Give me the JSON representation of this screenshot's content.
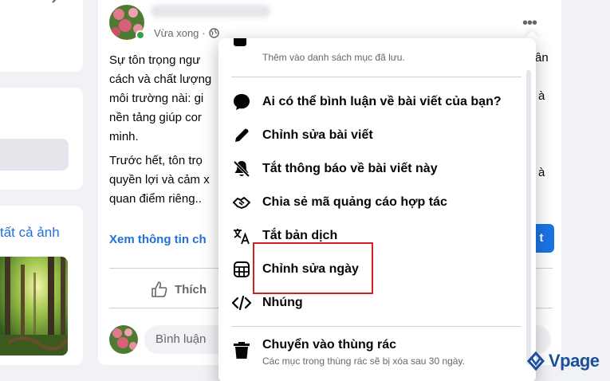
{
  "left": {
    "all_photos_link": "tất cả ảnh"
  },
  "post": {
    "timestamp": "Vừa xong",
    "separator": "·",
    "paragraph1": "Sự tôn trọng ngư",
    "paragraph1_l2": "cách và chất lượng",
    "paragraph1_l3": "môi trường nài: gi",
    "paragraph1_l4": "nền tảng giúp cor",
    "paragraph1_l5": "minh.",
    "paragraph2": "Trước hết, tôn trọ",
    "paragraph2_l2": "quyền lợi và cảm x",
    "paragraph2_l3": "quan điểm riêng..",
    "right_frag1": "ân",
    "right_frag2": "à",
    "right_frag3": "à",
    "link_text": "Xem thông tin ch",
    "blue_button_label": "t",
    "like_label": "Thích",
    "comment_placeholder": "Bình luận"
  },
  "menu": {
    "top_subtitle": "Thêm vào danh sách mục đã lưu.",
    "items": [
      {
        "label": "Ai có thể bình luận về bài viết của bạn?",
        "icon": "comment-bubble-icon"
      },
      {
        "label": "Chỉnh sửa bài viết",
        "icon": "pencil-icon"
      },
      {
        "label": "Tắt thông báo về bài viết này",
        "icon": "bell-off-icon"
      },
      {
        "label": "Chia sẻ mã quảng cáo hợp tác",
        "icon": "handshake-icon"
      },
      {
        "label": "Tắt bản dịch",
        "icon": "translate-icon"
      },
      {
        "label": "Chỉnh sửa ngày",
        "icon": "calendar-icon"
      },
      {
        "label": "Nhúng",
        "icon": "code-icon"
      },
      {
        "label": "Chuyển vào thùng rác",
        "sub": "Các mục trong thùng rác sẽ bị xóa sau 30 ngày.",
        "icon": "trash-icon"
      }
    ]
  },
  "watermark": {
    "text": "Vpage"
  },
  "colors": {
    "accent": "#1b74e4",
    "link": "#216fdb",
    "highlight": "#d41f26"
  }
}
